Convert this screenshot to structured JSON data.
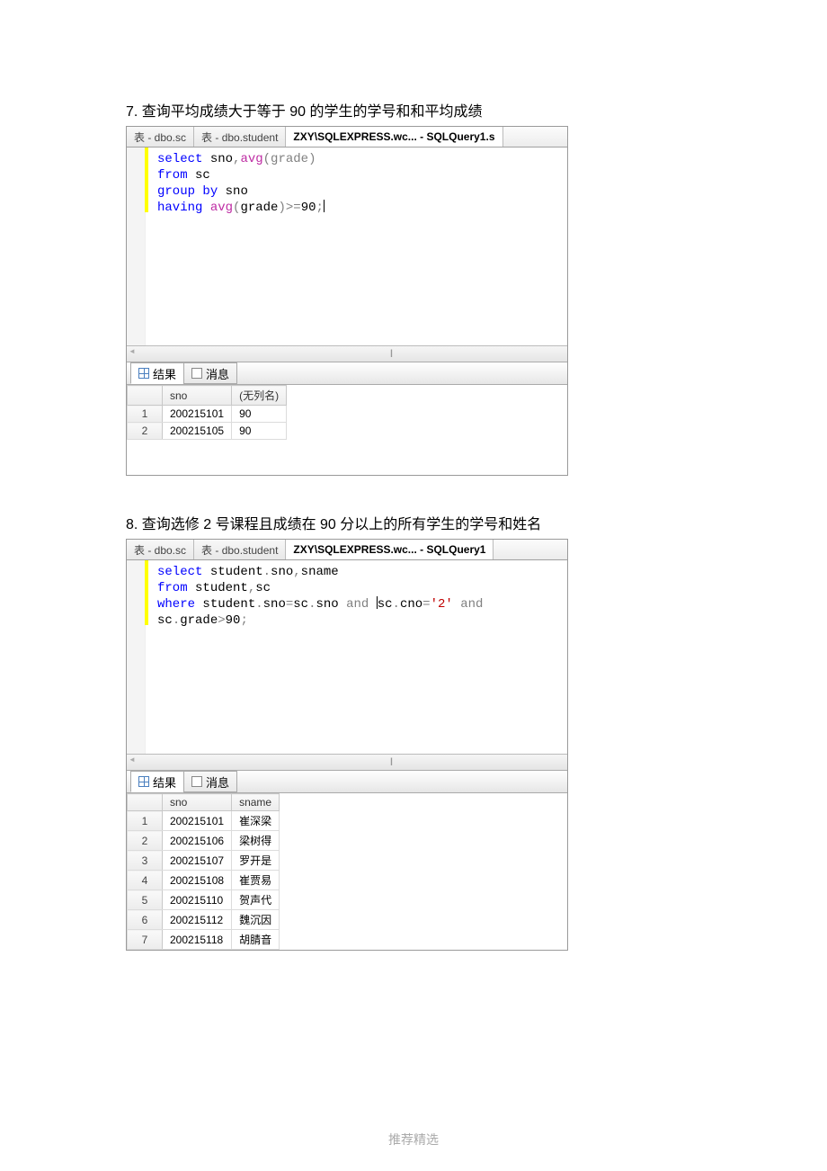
{
  "q7": {
    "heading": "7. 查询平均成绩大于等于 90 的学生的学号和和平均成绩",
    "tabs": [
      "表 - dbo.sc",
      "表 - dbo.student",
      "ZXY\\SQLEXPRESS.wc... - SQLQuery1.s"
    ],
    "sql": {
      "line1_kw": "select",
      "line1_sno": " sno",
      "line1_comma": ",",
      "line1_fn": "avg",
      "line1_paren": "(grade)",
      "line2_kw": "from",
      "line2_rest": " sc",
      "line3_kw": "group",
      "line3_kw2": " by",
      "line3_rest": " sno",
      "line4_kw": "having",
      "line4_sp": " ",
      "line4_fn": "avg",
      "line4_p1": "(",
      "line4_fld": "grade",
      "line4_p2": ")",
      "line4_op": ">=",
      "line4_num": "90",
      "line4_semi": ";"
    },
    "result_tabs": {
      "results": "结果",
      "messages": "消息"
    },
    "columns": [
      "sno",
      "(无列名)"
    ],
    "rows": [
      {
        "n": "1",
        "sno": "200215101",
        "v": "90"
      },
      {
        "n": "2",
        "sno": "200215105",
        "v": "90"
      }
    ]
  },
  "q8": {
    "heading": "8. 查询选修 2 号课程且成绩在 90 分以上的所有学生的学号和姓名",
    "tabs": [
      "表 - dbo.sc",
      "表 - dbo.student",
      "ZXY\\SQLEXPRESS.wc... - SQLQuery1"
    ],
    "sql": {
      "l1_kw": "select",
      "l1_rest": " student",
      "l1_d1": ".",
      "l1_sno": "sno",
      "l1_c": ",",
      "l1_sname": "sname",
      "l2_kw": "from",
      "l2_rest": " student",
      "l2_c": ",",
      "l2_sc": "sc",
      "l3_kw": "where",
      "l3_p1": " student",
      "l3_d1": ".",
      "l3_sno1": "sno",
      "l3_eq1": "=",
      "l3_sc1": "sc",
      "l3_d2": ".",
      "l3_sno2": "sno",
      "l3_sp1": " ",
      "l3_and1": "and",
      "l3_sp2": " ",
      "l3_sc2": "sc",
      "l3_d3": ".",
      "l3_cno": "cno",
      "l3_eq2": "=",
      "l3_str": "'2'",
      "l3_sp3": " ",
      "l3_and2": "and",
      "l4_p1": "sc",
      "l4_d1": ".",
      "l4_fld": "grade",
      "l4_op": ">",
      "l4_num": "90",
      "l4_semi": ";"
    },
    "result_tabs": {
      "results": "结果",
      "messages": "消息"
    },
    "columns": [
      "sno",
      "sname"
    ],
    "rows": [
      {
        "n": "1",
        "sno": "200215101",
        "sname": "崔深梁"
      },
      {
        "n": "2",
        "sno": "200215106",
        "sname": "梁树得"
      },
      {
        "n": "3",
        "sno": "200215107",
        "sname": "罗开是"
      },
      {
        "n": "4",
        "sno": "200215108",
        "sname": "崔贾易"
      },
      {
        "n": "5",
        "sno": "200215110",
        "sname": "贺声代"
      },
      {
        "n": "6",
        "sno": "200215112",
        "sname": "魏沉因"
      },
      {
        "n": "7",
        "sno": "200215118",
        "sname": "胡腈音"
      }
    ]
  },
  "footer": "推荐精选"
}
